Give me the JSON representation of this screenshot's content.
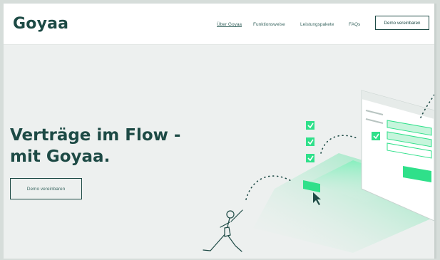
{
  "header": {
    "logo": "Goyaa",
    "nav": [
      {
        "label": "Über Goyaa",
        "active": true
      },
      {
        "label": "Funktionsweise",
        "active": false
      },
      {
        "label": "Leistungspakete",
        "active": false
      },
      {
        "label": "FAQs",
        "active": false
      }
    ],
    "cta_label": "Demo vereinbaren"
  },
  "hero": {
    "title_line1": "Verträge im Flow -",
    "title_line2": "mit Goyaa.",
    "cta_label": "Demo vereinbaren"
  },
  "colors": {
    "brand_dark": "#1d4a45",
    "accent_green": "#2fe08a",
    "background": "#edf0ef"
  }
}
